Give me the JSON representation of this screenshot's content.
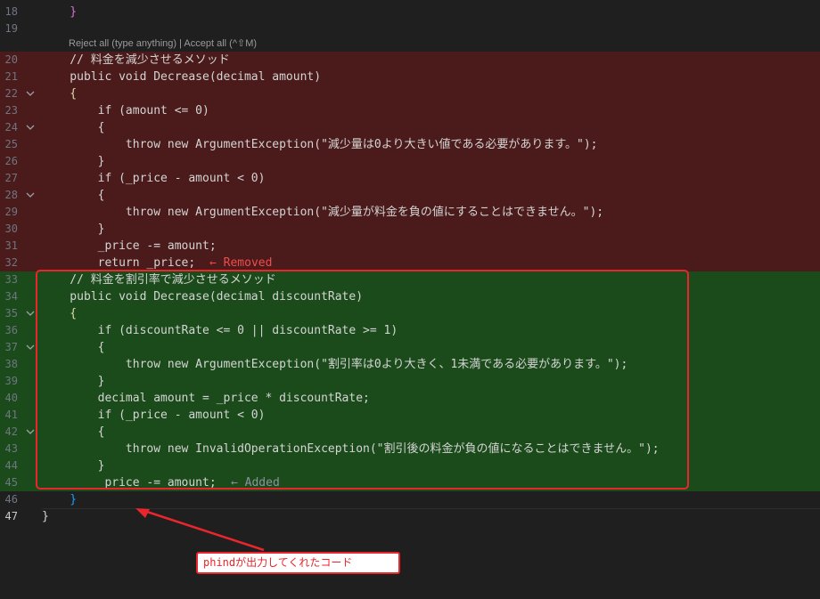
{
  "codelens": "Reject all (type anything) | Accept all (^⇧M)",
  "lines": [
    {
      "n": "18",
      "text": "    }",
      "type": "",
      "fold": ""
    },
    {
      "n": "19",
      "text": "",
      "type": "",
      "fold": ""
    },
    {
      "n": "20",
      "text": "    // 料金を減少させるメソッド",
      "type": "removed",
      "fold": ""
    },
    {
      "n": "21",
      "text": "    public void Decrease(decimal amount)",
      "type": "removed",
      "fold": ""
    },
    {
      "n": "22",
      "text": "    {",
      "type": "removed",
      "fold": "v"
    },
    {
      "n": "23",
      "text": "        if (amount <= 0)",
      "type": "removed",
      "fold": ""
    },
    {
      "n": "24",
      "text": "        {",
      "type": "removed",
      "fold": "v"
    },
    {
      "n": "25",
      "text": "            throw new ArgumentException(\"減少量は0より大きい値である必要があります。\");",
      "type": "removed",
      "fold": ""
    },
    {
      "n": "26",
      "text": "        }",
      "type": "removed",
      "fold": ""
    },
    {
      "n": "27",
      "text": "        if (_price - amount < 0)",
      "type": "removed",
      "fold": ""
    },
    {
      "n": "28",
      "text": "        {",
      "type": "removed",
      "fold": "v"
    },
    {
      "n": "29",
      "text": "            throw new ArgumentException(\"減少量が料金を負の値にすることはできません。\");",
      "type": "removed",
      "fold": ""
    },
    {
      "n": "30",
      "text": "        }",
      "type": "removed",
      "fold": ""
    },
    {
      "n": "31",
      "text": "        _price -= amount;",
      "type": "removed",
      "fold": ""
    },
    {
      "n": "32",
      "text": "        return _price;",
      "type": "removed",
      "fold": "",
      "note": "← Removed",
      "note_type": "removed"
    },
    {
      "n": "33",
      "text": "    // 料金を割引率で減少させるメソッド",
      "type": "added",
      "fold": ""
    },
    {
      "n": "34",
      "text": "    public void Decrease(decimal discountRate)",
      "type": "added",
      "fold": ""
    },
    {
      "n": "35",
      "text": "    {",
      "type": "added",
      "fold": "v"
    },
    {
      "n": "36",
      "text": "        if (discountRate <= 0 || discountRate >= 1)",
      "type": "added",
      "fold": ""
    },
    {
      "n": "37",
      "text": "        {",
      "type": "added",
      "fold": "v"
    },
    {
      "n": "38",
      "text": "            throw new ArgumentException(\"割引率は0より大きく、1未満である必要があります。\");",
      "type": "added",
      "fold": ""
    },
    {
      "n": "39",
      "text": "        }",
      "type": "added",
      "fold": ""
    },
    {
      "n": "40",
      "text": "        decimal amount = _price * discountRate;",
      "type": "added",
      "fold": ""
    },
    {
      "n": "41",
      "text": "        if (_price - amount < 0)",
      "type": "added",
      "fold": ""
    },
    {
      "n": "42",
      "text": "        {",
      "type": "added",
      "fold": "v"
    },
    {
      "n": "43",
      "text": "            throw new InvalidOperationException(\"割引後の料金が負の値になることはできません。\");",
      "type": "added",
      "fold": ""
    },
    {
      "n": "44",
      "text": "        }",
      "type": "added",
      "fold": ""
    },
    {
      "n": "45",
      "text": "        _price -= amount;",
      "type": "added",
      "fold": "",
      "note": "← Added",
      "note_type": "added"
    },
    {
      "n": "46",
      "text": "    }",
      "type": "",
      "fold": ""
    },
    {
      "n": "47",
      "text": "}",
      "type": "",
      "fold": ""
    }
  ],
  "callout": "phindが出力してくれたコード",
  "colors": {
    "removed_bg": "#4b1a1a",
    "added_bg": "#1b4b1b",
    "annotation_red": "#e8262b"
  }
}
